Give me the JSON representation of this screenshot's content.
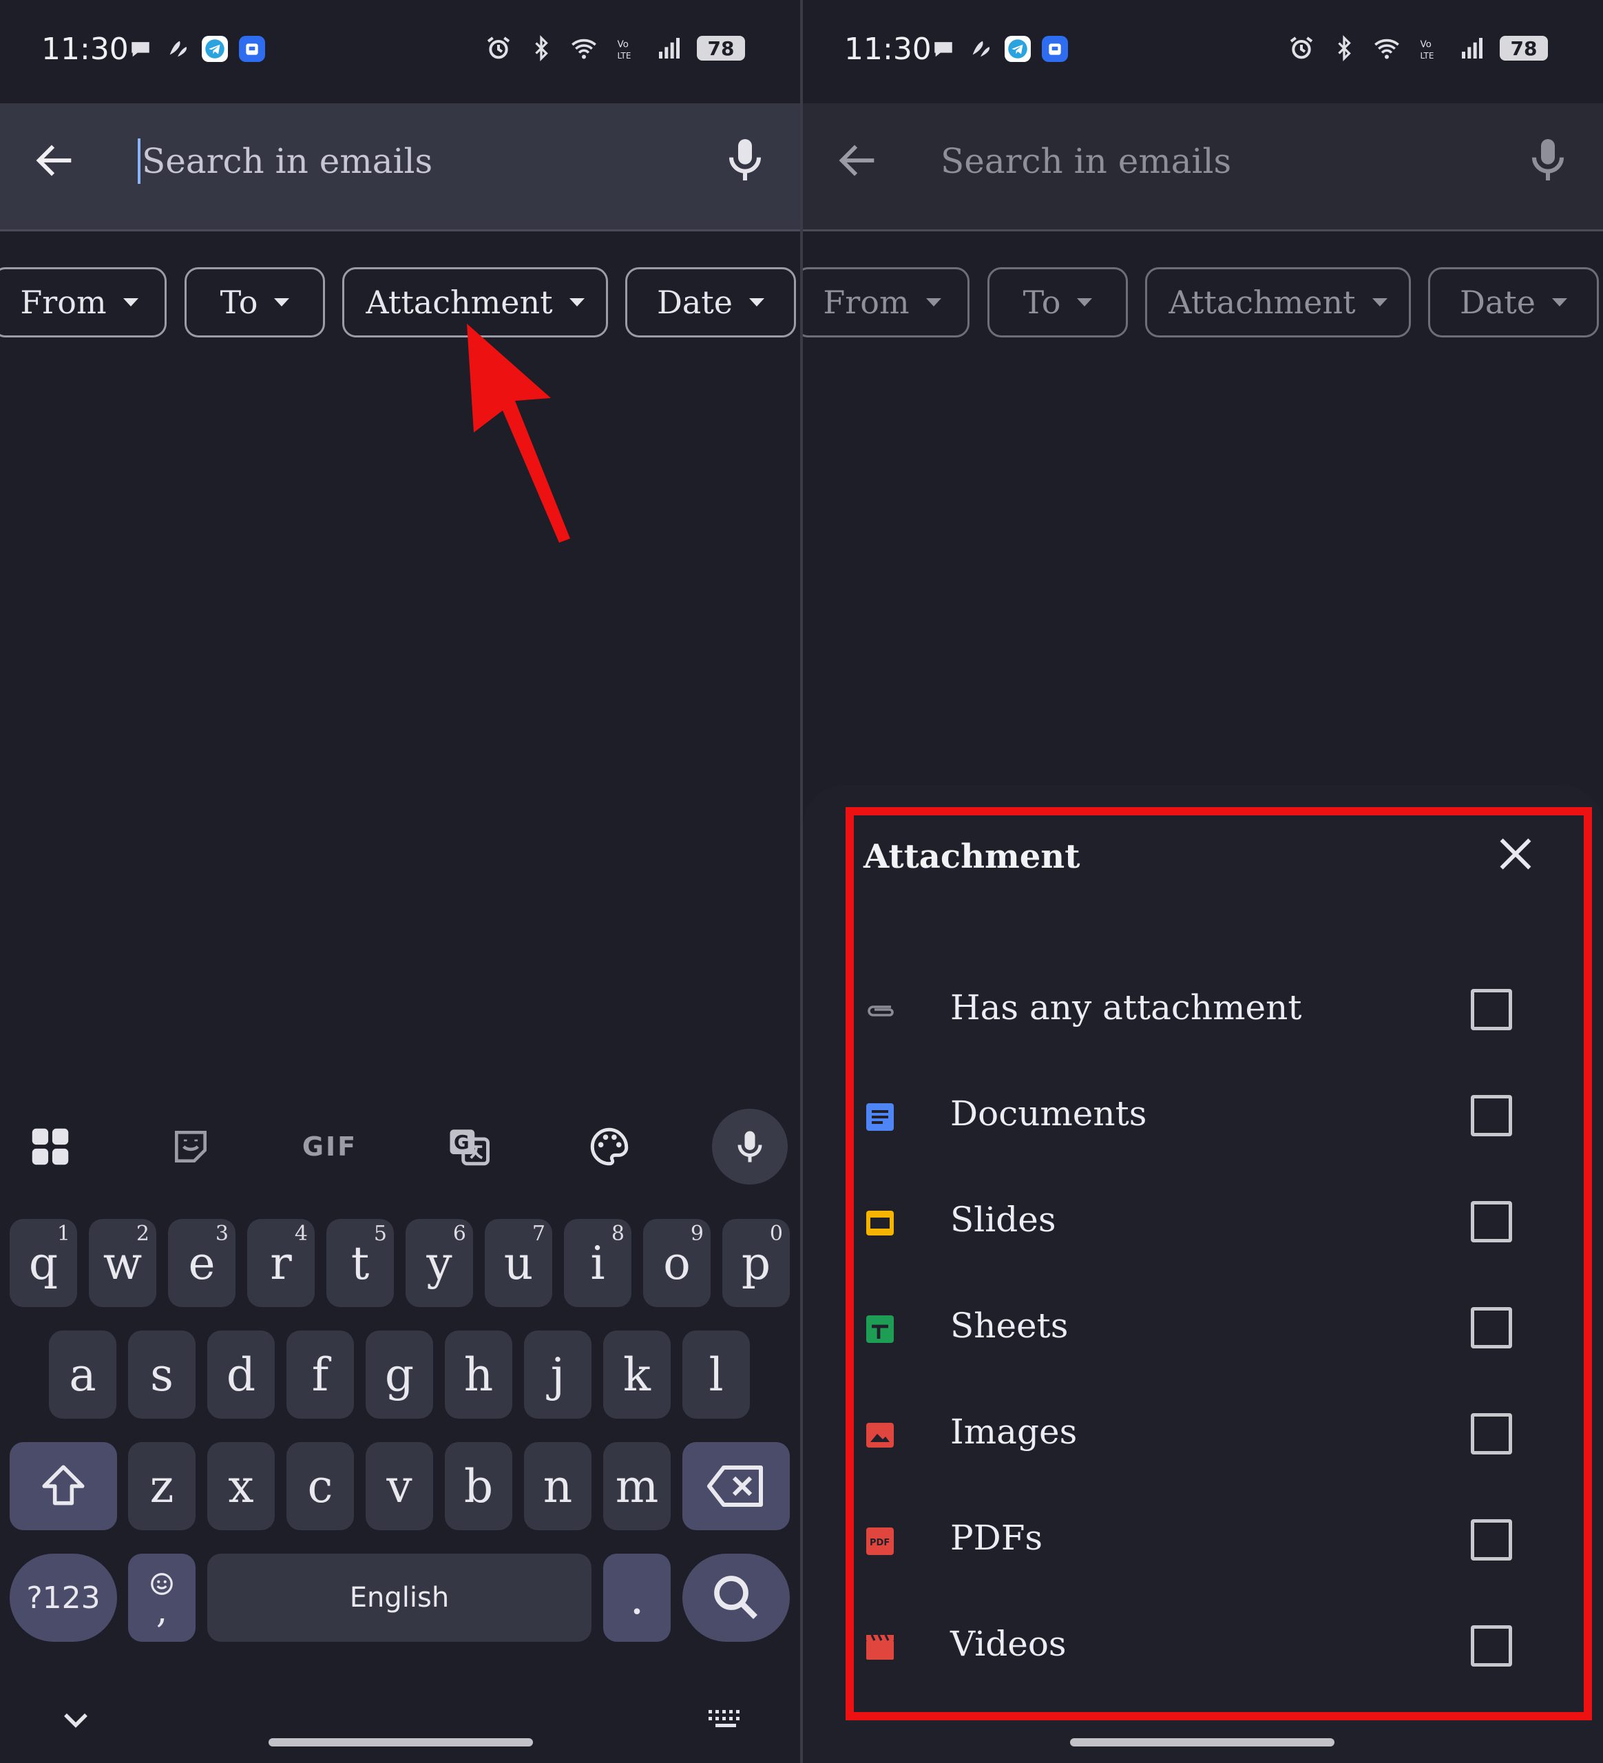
{
  "status_bar": {
    "time": "11:30",
    "battery": "78"
  },
  "search": {
    "placeholder": "Search in emails"
  },
  "chips": {
    "from": "From",
    "to": "To",
    "attachment": "Attachment",
    "date": "Date"
  },
  "keyboard": {
    "row1": [
      "q",
      "w",
      "e",
      "r",
      "t",
      "y",
      "u",
      "i",
      "o",
      "p"
    ],
    "row1_nums": [
      "1",
      "2",
      "3",
      "4",
      "5",
      "6",
      "7",
      "8",
      "9",
      "0"
    ],
    "row2": [
      "a",
      "s",
      "d",
      "f",
      "g",
      "h",
      "j",
      "k",
      "l"
    ],
    "row3": [
      "z",
      "x",
      "c",
      "v",
      "b",
      "n",
      "m"
    ],
    "symbols_key": "?123",
    "comma_key": ",",
    "space_label": "English",
    "period_key": ".",
    "gif_label": "GIF"
  },
  "sheet": {
    "title": "Attachment",
    "options": [
      {
        "label": "Has any attachment",
        "icon": "paperclip-icon",
        "color": "#8a8b93",
        "checked": false
      },
      {
        "label": "Documents",
        "icon": "docs-icon",
        "color": "#4f86f7",
        "checked": false
      },
      {
        "label": "Slides",
        "icon": "slides-icon",
        "color": "#f4b400",
        "checked": false
      },
      {
        "label": "Sheets",
        "icon": "sheets-icon",
        "color": "#1e9e55",
        "checked": false
      },
      {
        "label": "Images",
        "icon": "image-icon",
        "color": "#e0463d",
        "checked": false
      },
      {
        "label": "PDFs",
        "icon": "pdf-icon",
        "color": "#e0463d",
        "checked": false
      },
      {
        "label": "Videos",
        "icon": "video-icon",
        "color": "#e0463d",
        "checked": false
      }
    ]
  },
  "colors": {
    "background": "#1d1e27",
    "highlight": "#ee1111",
    "arrow": "#ee1111",
    "accent": "#8ab4f8"
  }
}
